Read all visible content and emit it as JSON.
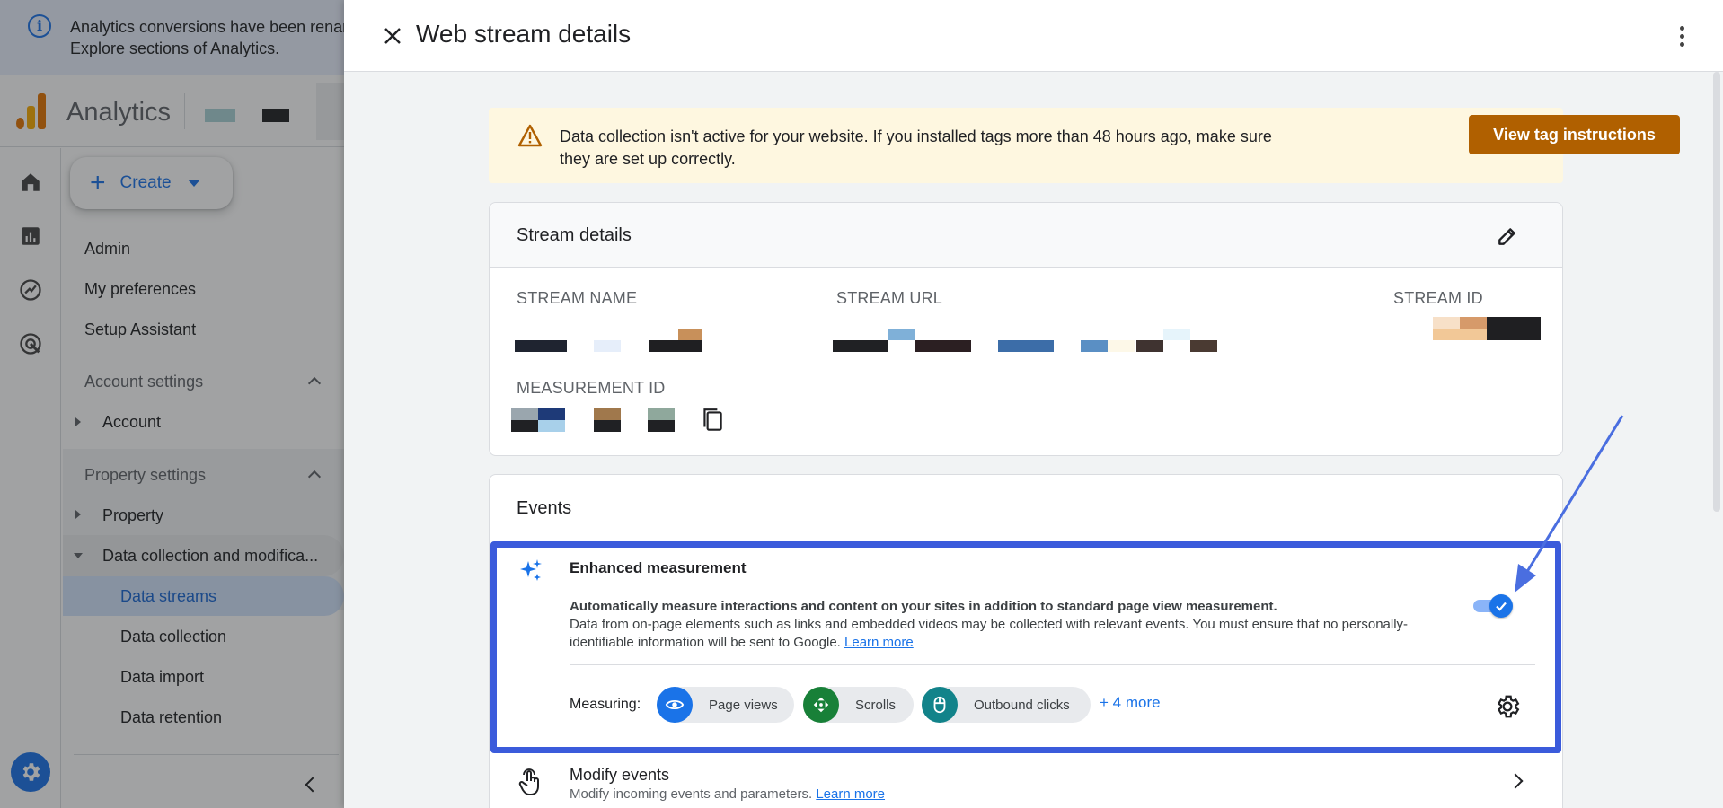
{
  "notice": {
    "line1": "Analytics conversions have been renar",
    "line2": "Explore sections of Analytics."
  },
  "app": {
    "name": "Analytics"
  },
  "create_button": {
    "label": "Create"
  },
  "nav": {
    "admin": "Admin",
    "my_preferences": "My preferences",
    "setup_assistant": "Setup Assistant",
    "account_settings": "Account settings",
    "account": "Account",
    "property_settings": "Property settings",
    "property": "Property",
    "data_collection_mod": "Data collection and modifica...",
    "data_streams": "Data streams",
    "data_collection": "Data collection",
    "data_import": "Data import",
    "data_retention": "Data retention"
  },
  "drawer": {
    "title": "Web stream details"
  },
  "warning": {
    "message": "Data collection isn't active for your website. If you installed tags more than 48 hours ago, make sure they are set up correctly.",
    "button": "View tag instructions"
  },
  "stream_details": {
    "title": "Stream details",
    "stream_name_label": "STREAM NAME",
    "stream_url_label": "STREAM URL",
    "stream_id_label": "STREAM ID",
    "measurement_id_label": "MEASUREMENT ID"
  },
  "events": {
    "title": "Events",
    "enhanced": {
      "title": "Enhanced measurement",
      "desc_bold": "Automatically measure interactions and content on your sites in addition to standard page view measurement.",
      "desc": "Data from on-page elements such as links and embedded videos may be collected with relevant events. You must ensure that no personally-identifiable information will be sent to Google.",
      "learn_more": "Learn more",
      "toggle_on": true,
      "measuring_label": "Measuring:",
      "chips": [
        "Page views",
        "Scrolls",
        "Outbound clicks"
      ],
      "more": "+ 4 more"
    },
    "modify": {
      "title": "Modify events",
      "desc": "Modify incoming events and parameters.",
      "learn_more": "Learn more"
    }
  },
  "colors": {
    "accent": "#1a73e8",
    "highlight": "#3b5bdb",
    "warning_bg": "#fef7e0",
    "warning_button": "#b06000",
    "chip_green": "#188038",
    "chip_teal": "#12838a"
  },
  "icons": [
    "info-icon",
    "analytics-logo",
    "home-icon",
    "reports-icon",
    "explore-icon",
    "advertising-icon",
    "settings-icon",
    "close-icon",
    "more-vert-icon",
    "warning-icon",
    "edit-icon",
    "copy-icon",
    "sparkle-icon",
    "check-icon",
    "eye-icon",
    "scroll-icon",
    "mouse-icon",
    "gear-icon",
    "touch-icon",
    "chevron-right-icon",
    "chevron-left-icon"
  ]
}
